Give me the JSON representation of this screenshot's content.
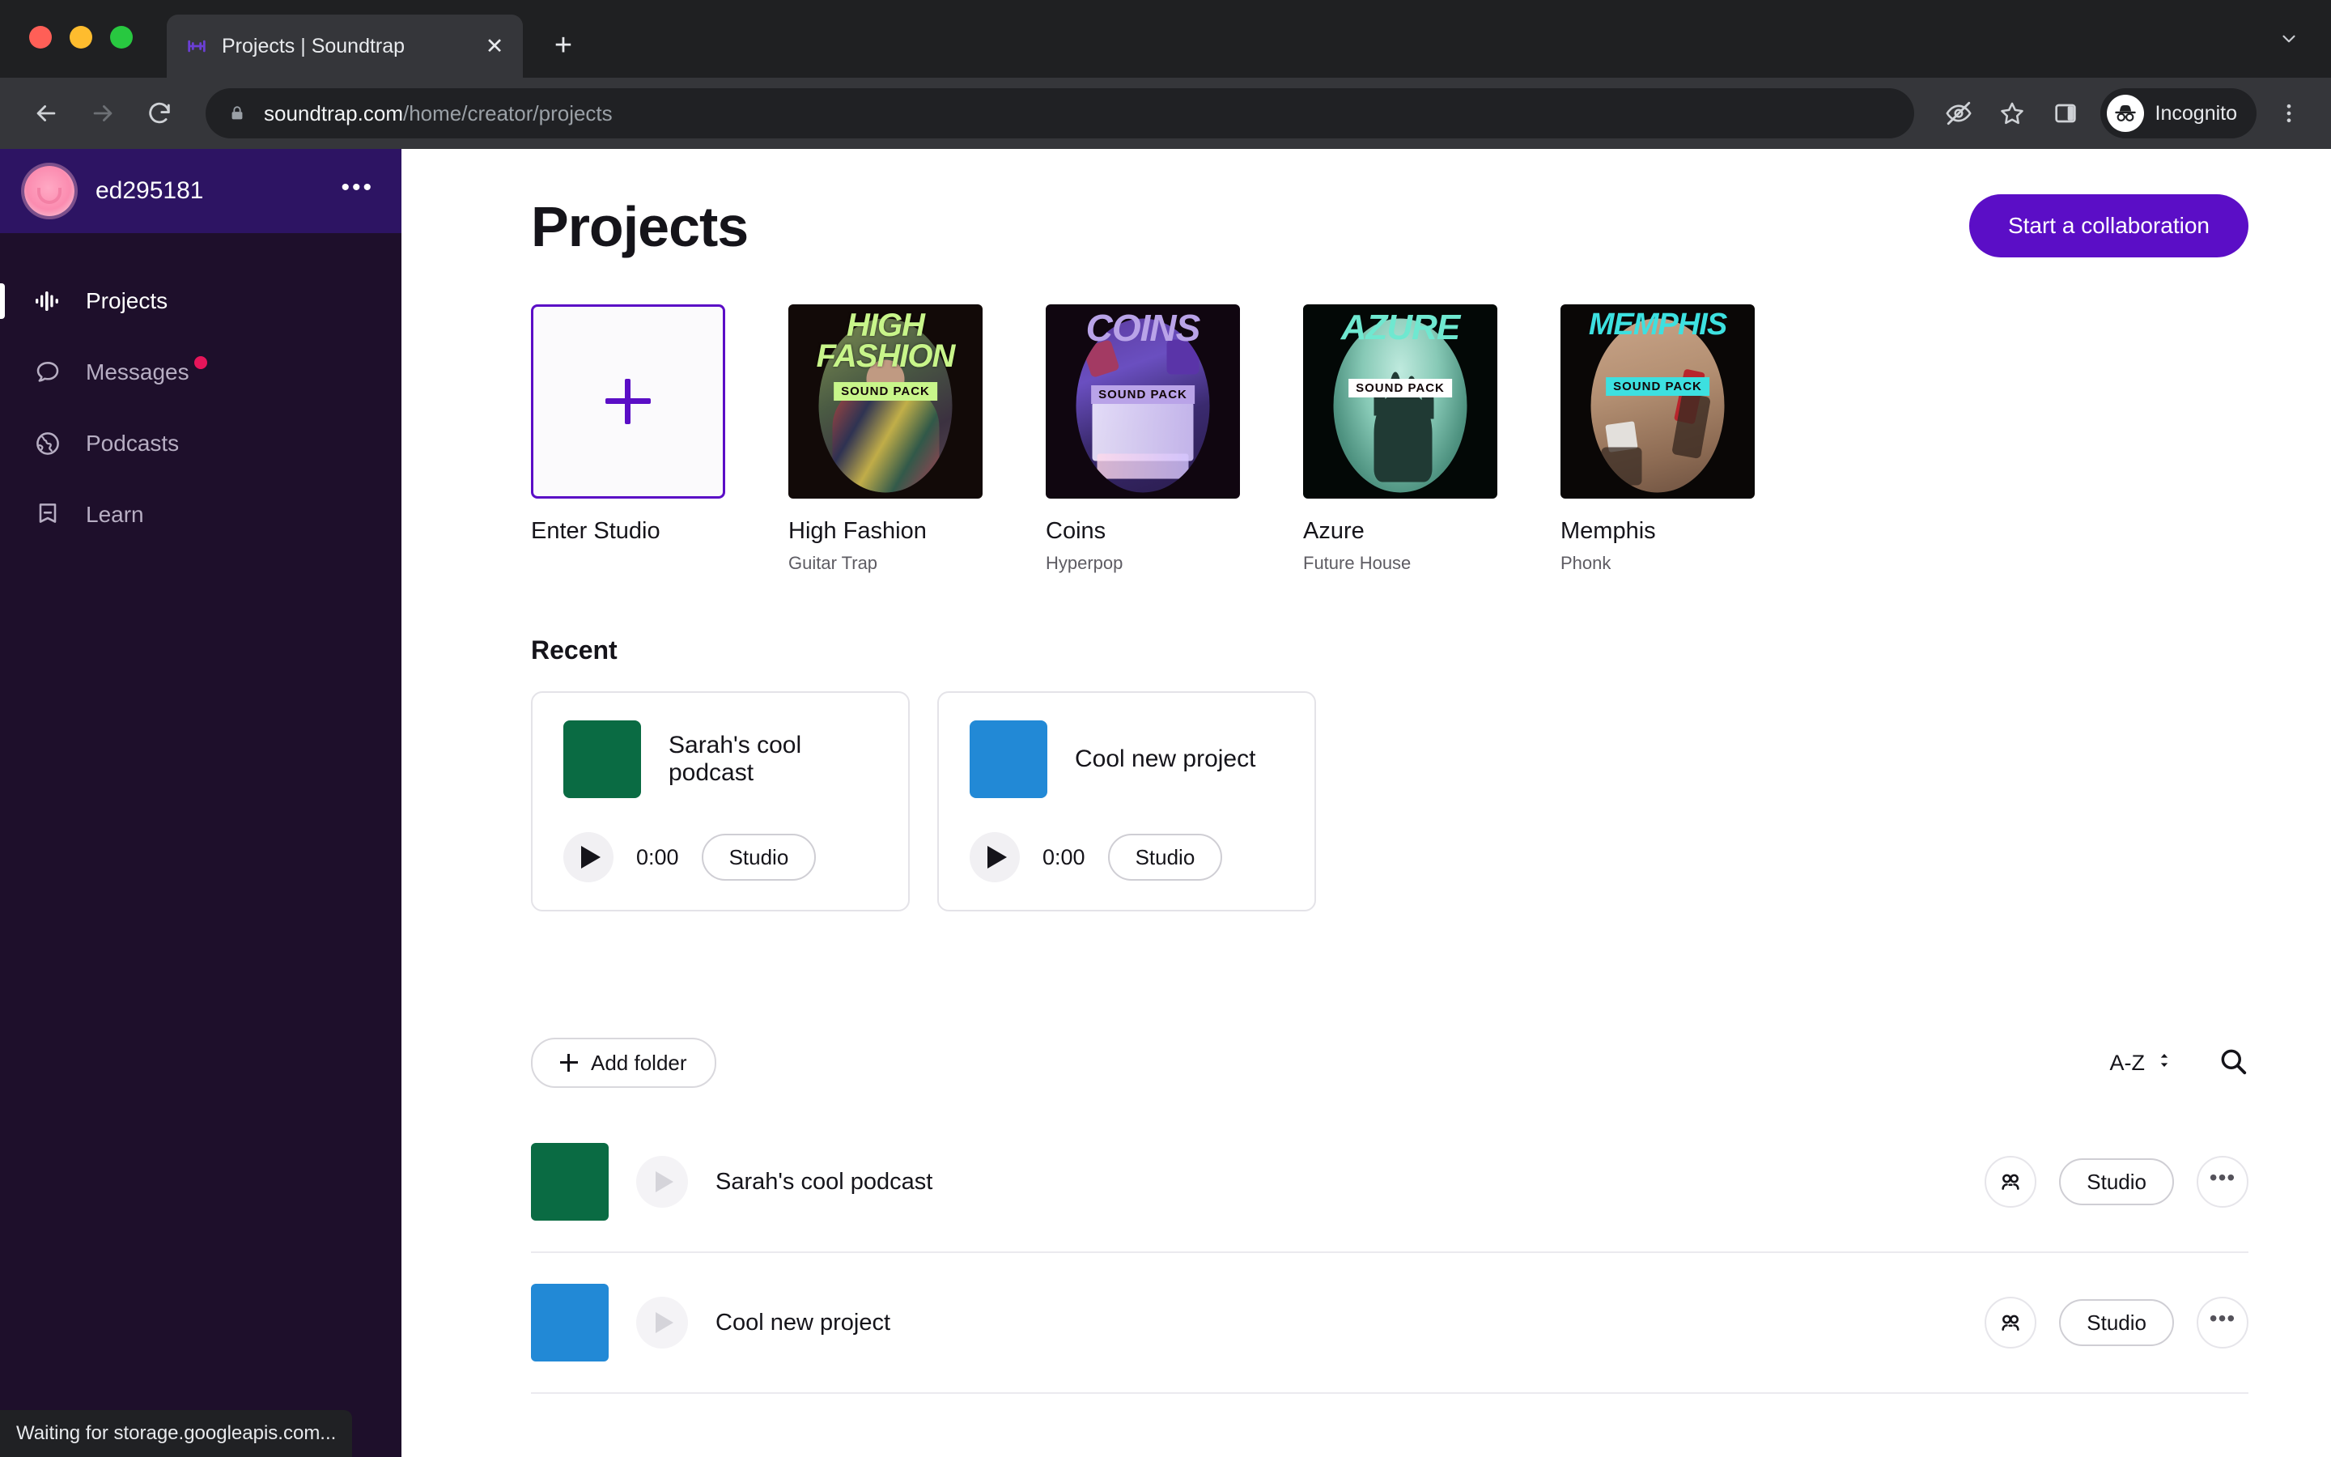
{
  "browser": {
    "tab": {
      "title": "Projects | Soundtrap",
      "favicon_icon": "soundtrap-favicon",
      "close_icon": "close-icon"
    },
    "new_tab_icon": "plus-icon",
    "tab_list_icon": "chevron-down-icon",
    "nav": {
      "back_icon": "back-arrow-icon",
      "forward_icon": "forward-arrow-icon",
      "reload_icon": "reload-icon"
    },
    "omnibox": {
      "lock_icon": "lock-icon",
      "url_host": "soundtrap.com",
      "url_path": "/home/creator/projects"
    },
    "toolbar_icons": [
      "eye-slash-icon",
      "star-icon",
      "side-panel-icon"
    ],
    "incognito": {
      "label": "Incognito",
      "icon": "incognito-hat-icon"
    },
    "menu_icon": "three-dots-vertical-icon",
    "status_text": "Waiting for storage.googleapis.com..."
  },
  "sidebar": {
    "username": "ed295181",
    "avatar_icon": "user-avatar",
    "more_icon": "more-horizontal-icon",
    "items": [
      {
        "label": "Projects",
        "icon": "waveform-icon",
        "active": true,
        "badge": false
      },
      {
        "label": "Messages",
        "icon": "chat-bubble-icon",
        "active": false,
        "badge": true
      },
      {
        "label": "Podcasts",
        "icon": "globe-icon",
        "active": false,
        "badge": false
      },
      {
        "label": "Learn",
        "icon": "book-icon",
        "active": false,
        "badge": false
      }
    ]
  },
  "main": {
    "page_title": "Projects",
    "collab_button": "Start a collaboration",
    "packs": [
      {
        "name": "Enter Studio",
        "genre": "",
        "kind": "new",
        "plus_icon": "plus-icon"
      },
      {
        "name": "High Fashion",
        "genre": "Guitar Trap",
        "kind": "pack",
        "wordmark": "HIGH FASHION",
        "badge": "SOUND PACK",
        "accent": "#c8f58a",
        "badge_bg": "#c8f58a"
      },
      {
        "name": "Coins",
        "genre": "Hyperpop",
        "kind": "pack",
        "wordmark": "COINS",
        "badge": "SOUND PACK",
        "accent": "#b9a3e8",
        "badge_bg": "#b9a3e8"
      },
      {
        "name": "Azure",
        "genre": "Future House",
        "kind": "pack",
        "wordmark": "AZURE",
        "badge": "SOUND PACK",
        "accent": "#6fe8d0",
        "badge_bg": "#ffffff"
      },
      {
        "name": "Memphis",
        "genre": "Phonk",
        "kind": "pack",
        "wordmark": "MEMPHIS",
        "badge": "SOUND PACK",
        "accent": "#3de0e0",
        "badge_bg": "#3de0e0"
      }
    ],
    "recent_heading": "Recent",
    "recent": [
      {
        "name": "Sarah's cool podcast",
        "time": "0:00",
        "studio_label": "Studio",
        "color": "#0a6b43",
        "play_icon": "play-icon"
      },
      {
        "name": "Cool new project",
        "time": "0:00",
        "studio_label": "Studio",
        "color": "#2289d6",
        "play_icon": "play-icon"
      }
    ],
    "add_folder_label": "Add folder",
    "add_folder_icon": "plus-icon",
    "sort_label": "A-Z",
    "sort_icon": "sort-updown-icon",
    "search_icon": "search-icon",
    "project_rows": [
      {
        "name": "Sarah's cool podcast",
        "color": "#0a6b43",
        "play_icon": "play-icon",
        "collaborators_icon": "people-icon",
        "studio_label": "Studio",
        "menu_icon": "more-horizontal-icon"
      },
      {
        "name": "Cool new project",
        "color": "#2289d6",
        "play_icon": "play-icon",
        "collaborators_icon": "people-icon",
        "studio_label": "Studio",
        "menu_icon": "more-horizontal-icon"
      }
    ]
  },
  "colors": {
    "brand_purple": "#5b0ec6",
    "sidebar_bg": "#1e0f2b",
    "sidebar_header_bg": "#2d1463",
    "badge_red": "#e6155a"
  }
}
